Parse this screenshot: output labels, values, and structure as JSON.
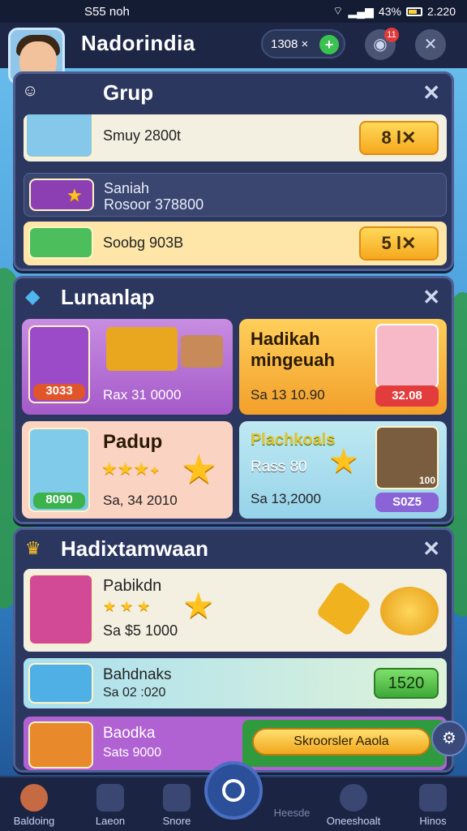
{
  "status": {
    "time": "S55 noh",
    "battery": "43%",
    "clock": "2.220"
  },
  "header": {
    "title": "Nadorindia",
    "coins": "1308 ×",
    "plus": "+",
    "notif_count": "11"
  },
  "group": {
    "title": "Grup",
    "close": "✕",
    "rows": [
      {
        "label": "Smuy 2800t",
        "button": "8 l✕"
      },
      {
        "label1": "Saniah",
        "label2": "Rosoor 378800"
      },
      {
        "label": "Soobg 903B",
        "button": "5 l✕"
      }
    ]
  },
  "lunanlap": {
    "title": "Lunanlap",
    "close": "✕",
    "cards": [
      {
        "label": "Rax 31 0000",
        "badge": "3033"
      },
      {
        "title": "Hadikah mingeuah",
        "label": "Sa 13 10.90",
        "badge": "32.08"
      },
      {
        "title": "Padup",
        "label": "Sa, 34 2010",
        "badge": "8090"
      },
      {
        "title": "Plachkoals",
        "sub": "Rass 80",
        "label": "Sa 13,2000",
        "badge": "S0Z5",
        "small": "100"
      }
    ]
  },
  "hadiktam": {
    "title": "Hadixtamwaan",
    "close": "✕",
    "rows": [
      {
        "title": "Pabikdn",
        "label": "Sa $5 1000"
      },
      {
        "title": "Bahdnaks",
        "label": "Sa 02 :020",
        "button": "1520"
      },
      {
        "title": "Baodka",
        "label": "Sats 9000",
        "button": "Skroorsler Aaola"
      }
    ]
  },
  "nav": [
    {
      "label": "Baldoing"
    },
    {
      "label": "Laeon"
    },
    {
      "label": "Snore"
    },
    {
      "label": "Heesde"
    },
    {
      "label": "Oneeshoalt"
    },
    {
      "label": "Hinos"
    }
  ],
  "colors": {
    "gold": "#f6a81e",
    "panel": "#2c3760",
    "accent_green": "#39c24f"
  }
}
